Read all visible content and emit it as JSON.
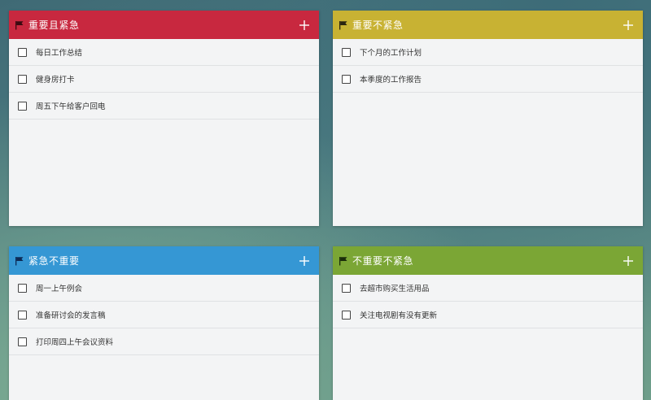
{
  "quadrants": [
    {
      "id": "q1",
      "title": "重要且紧急",
      "color": "#c8283f",
      "flag_color": "#3a0a10",
      "tasks": [
        "每日工作总结",
        "健身房打卡",
        "周五下午给客户回电"
      ]
    },
    {
      "id": "q2",
      "title": "重要不紧急",
      "color": "#c8b233",
      "flag_color": "#2a2410",
      "tasks": [
        "下个月的工作计划",
        "本季度的工作报告"
      ]
    },
    {
      "id": "q3",
      "title": "紧急不重要",
      "color": "#3597d4",
      "flag_color": "#0d2a55",
      "tasks": [
        "周一上午例会",
        "准备研讨会的发言稿",
        "打印周四上午会议资料"
      ]
    },
    {
      "id": "q4",
      "title": "不重要不紧急",
      "color": "#7ba635",
      "flag_color": "#1a2c0a",
      "tasks": [
        "去超市购买生活用品",
        "关注电视剧有没有更新"
      ]
    }
  ]
}
